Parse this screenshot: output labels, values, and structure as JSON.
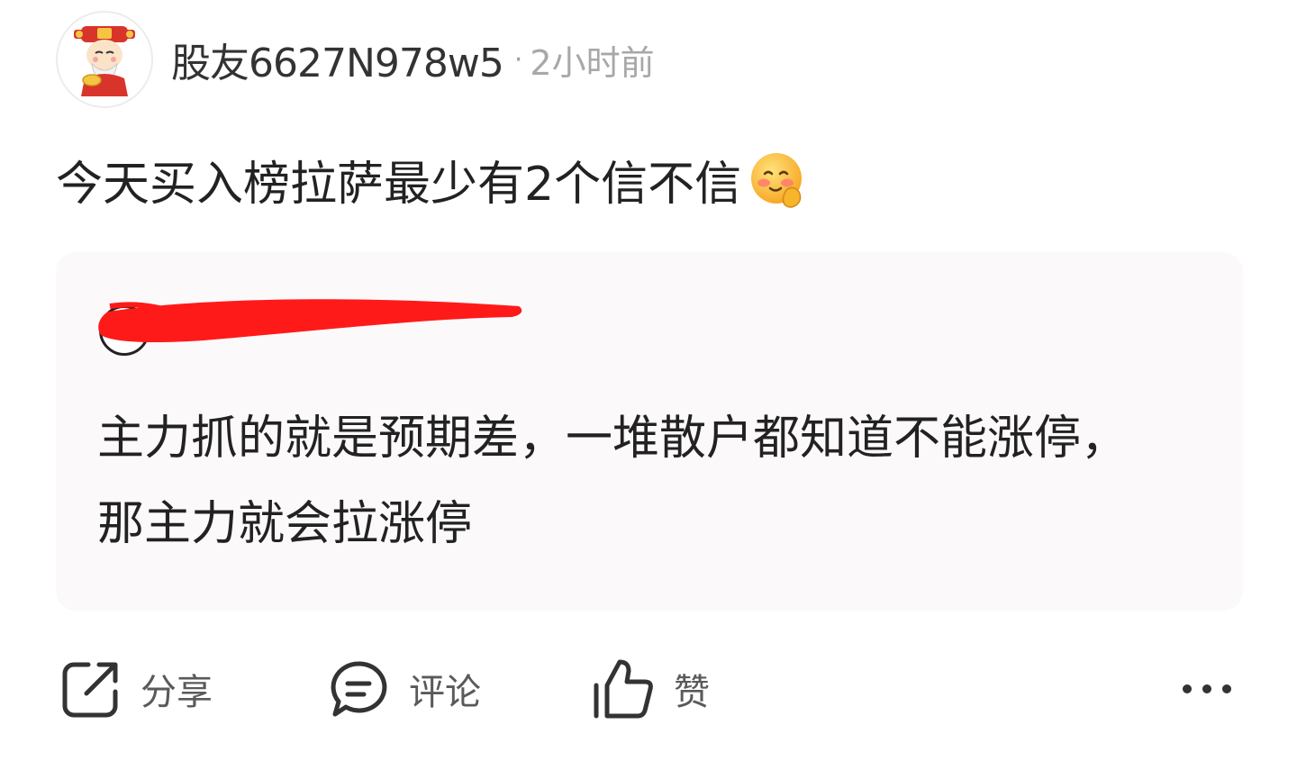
{
  "post": {
    "author": "股友6627N978w5",
    "separator": "·",
    "time": "2小时前",
    "text": "今天买入榜拉萨最少有2个信不信",
    "emoji": "blush-hand-emoji"
  },
  "quote": {
    "author": "",
    "text": "主力抓的就是预期差，一堆散户都知道不能涨停，那主力就会拉涨停",
    "redaction_color": "#ff1a1a"
  },
  "actions": {
    "share": "分享",
    "comment": "评论",
    "like": "赞",
    "more": "more-icon"
  },
  "colors": {
    "card_bg": "#fcf9fb",
    "text": "#222222",
    "muted": "#a8a8a8"
  }
}
